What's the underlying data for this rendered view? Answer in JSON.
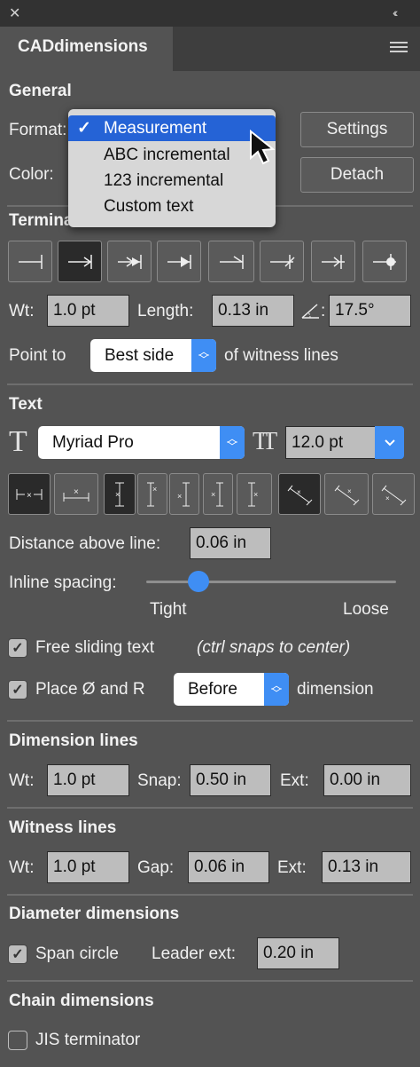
{
  "window": {
    "close_glyph": "✕",
    "collapse_glyph": "‹‹",
    "menu_glyph": "≡"
  },
  "tab": {
    "title": "CADdimensions"
  },
  "general": {
    "title": "General",
    "format_label": "Format:",
    "color_label": "Color:",
    "settings_button": "Settings",
    "detach_button": "Detach",
    "format_menu": {
      "check": "✓",
      "items": [
        "Measurement",
        "ABC incremental",
        "123 incremental",
        "Custom text"
      ],
      "selected_index": 0
    }
  },
  "terminators": {
    "title": "Terminators",
    "wt_label": "Wt:",
    "wt_value": "1.0 pt",
    "length_label": "Length:",
    "length_value": "0.13 in",
    "angle_label": ":",
    "angle_value": "17.5°",
    "point_to_label": "Point to",
    "point_to_value": "Best side",
    "point_to_suffix": "of witness lines",
    "buttons": [
      "terminator-bar",
      "terminator-arrow-in",
      "terminator-double-arrow",
      "terminator-filled-arrow",
      "terminator-open-arrow",
      "terminator-slash",
      "terminator-arrow-slash",
      "terminator-dot"
    ],
    "selected_index": 1
  },
  "text": {
    "title": "Text",
    "font_value": "Myriad Pro",
    "size_value": "12.0 pt",
    "distance_label": "Distance above line:",
    "distance_value": "0.06 in",
    "inline_spacing_label": "Inline spacing:",
    "inline_spacing_level": 0.21,
    "tight_label": "Tight",
    "loose_label": "Loose",
    "free_sliding_label": "Free sliding text",
    "free_sliding_checked": true,
    "free_sliding_note": "(ctrl snaps to center)",
    "place_label": "Place Ø and R",
    "place_checked": true,
    "place_value": "Before",
    "place_suffix": "dimension"
  },
  "dimension_lines": {
    "title": "Dimension lines",
    "wt_label": "Wt:",
    "wt_value": "1.0 pt",
    "snap_label": "Snap:",
    "snap_value": "0.50 in",
    "ext_label": "Ext:",
    "ext_value": "0.00 in"
  },
  "witness_lines": {
    "title": "Witness lines",
    "wt_label": "Wt:",
    "wt_value": "1.0 pt",
    "gap_label": "Gap:",
    "gap_value": "0.06 in",
    "ext_label": "Ext:",
    "ext_value": "0.13 in"
  },
  "diameter": {
    "title": "Diameter dimensions",
    "span_label": "Span circle",
    "span_checked": true,
    "leader_label": "Leader ext:",
    "leader_value": "0.20 in"
  },
  "chain": {
    "title": "Chain dimensions",
    "jis_label": "JIS terminator",
    "jis_checked": false
  },
  "colors": {
    "accent": "#3f8ef4",
    "highlight": "#2563d6",
    "panel": "#535353"
  }
}
